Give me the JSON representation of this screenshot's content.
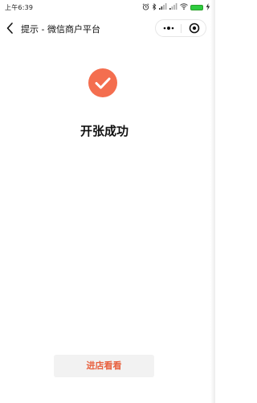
{
  "status_bar": {
    "time": "上午6:39",
    "battery_color": "#2ecc40"
  },
  "nav": {
    "title": "提示 - 微信商户平台",
    "back_icon": "chevron-left-icon",
    "more_icon": "more-dots-icon",
    "close_icon": "target-circle-icon"
  },
  "content": {
    "success_icon": "check-circle-icon",
    "success_icon_color": "#f46e4f",
    "message": "开张成功"
  },
  "actions": {
    "enter_store_label": "进店看看",
    "enter_store_color": "#e8613f"
  }
}
